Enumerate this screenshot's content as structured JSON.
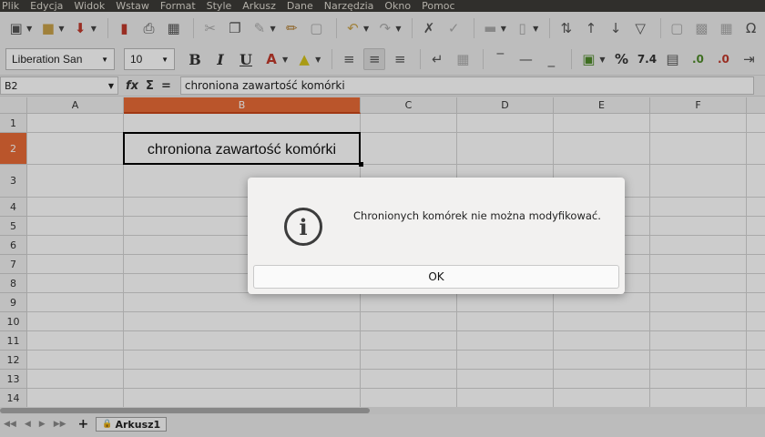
{
  "menu": [
    "Plik",
    "Edycja",
    "Widok",
    "Wstaw",
    "Format",
    "Style",
    "Arkusz",
    "Dane",
    "Narzędzia",
    "Okno",
    "Pomoc"
  ],
  "toolbar": {
    "font_name": "Liberation San",
    "font_size": "10",
    "bold": "B",
    "italic": "I",
    "underline": "U",
    "percent": "%",
    "number": "7.4"
  },
  "formula_bar": {
    "cell_ref": "B2",
    "fx": "fx",
    "sigma": "Σ",
    "equals": "=",
    "content": "chroniona zawartość komórki"
  },
  "columns": [
    "A",
    "B",
    "C",
    "D",
    "E",
    "F"
  ],
  "rows": [
    "1",
    "2",
    "3",
    "4",
    "5",
    "6",
    "7",
    "8",
    "9",
    "10",
    "11",
    "12",
    "13",
    "14"
  ],
  "active_cell": {
    "ref": "B2",
    "value": "chroniona zawartość komórki"
  },
  "sheets": [
    {
      "name": "Arkusz1"
    }
  ],
  "dialog": {
    "message": "Chronionych komórek nie można modyfikować.",
    "ok_label": "OK"
  },
  "colors": {
    "selection_header": "#e96b36",
    "menubar_bg": "#3c3b37"
  }
}
